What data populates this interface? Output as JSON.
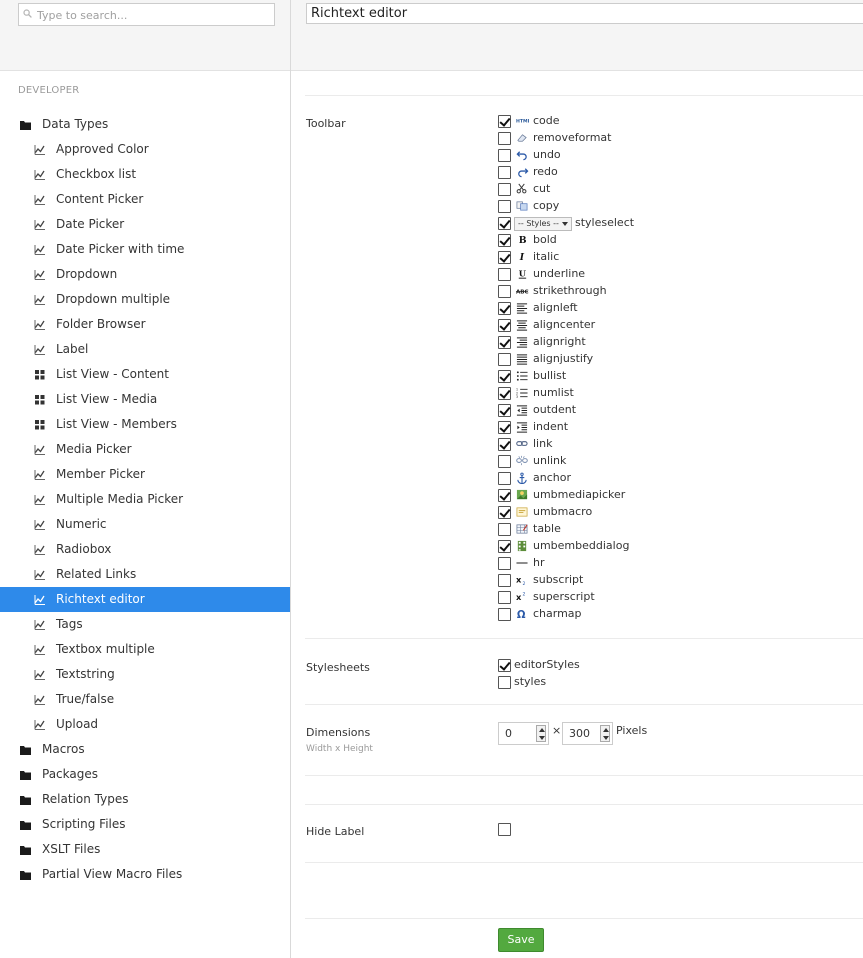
{
  "search": {
    "placeholder": "Type to search..."
  },
  "section": {
    "title": "DEVELOPER"
  },
  "tree": [
    {
      "label": "Data Types",
      "level": 0,
      "icon": "folder-icon"
    },
    {
      "label": "Approved Color",
      "level": 1,
      "icon": "datatype-icon"
    },
    {
      "label": "Checkbox list",
      "level": 1,
      "icon": "datatype-icon"
    },
    {
      "label": "Content Picker",
      "level": 1,
      "icon": "datatype-icon"
    },
    {
      "label": "Date Picker",
      "level": 1,
      "icon": "datatype-icon"
    },
    {
      "label": "Date Picker with time",
      "level": 1,
      "icon": "datatype-icon"
    },
    {
      "label": "Dropdown",
      "level": 1,
      "icon": "datatype-icon"
    },
    {
      "label": "Dropdown multiple",
      "level": 1,
      "icon": "datatype-icon"
    },
    {
      "label": "Folder Browser",
      "level": 1,
      "icon": "datatype-icon"
    },
    {
      "label": "Label",
      "level": 1,
      "icon": "datatype-icon"
    },
    {
      "label": "List View - Content",
      "level": 1,
      "icon": "grid-icon"
    },
    {
      "label": "List View - Media",
      "level": 1,
      "icon": "grid-icon"
    },
    {
      "label": "List View - Members",
      "level": 1,
      "icon": "grid-icon"
    },
    {
      "label": "Media Picker",
      "level": 1,
      "icon": "datatype-icon"
    },
    {
      "label": "Member Picker",
      "level": 1,
      "icon": "datatype-icon"
    },
    {
      "label": "Multiple Media Picker",
      "level": 1,
      "icon": "datatype-icon"
    },
    {
      "label": "Numeric",
      "level": 1,
      "icon": "datatype-icon"
    },
    {
      "label": "Radiobox",
      "level": 1,
      "icon": "datatype-icon"
    },
    {
      "label": "Related Links",
      "level": 1,
      "icon": "datatype-icon"
    },
    {
      "label": "Richtext editor",
      "level": 1,
      "icon": "datatype-icon",
      "selected": true
    },
    {
      "label": "Tags",
      "level": 1,
      "icon": "datatype-icon"
    },
    {
      "label": "Textbox multiple",
      "level": 1,
      "icon": "datatype-icon"
    },
    {
      "label": "Textstring",
      "level": 1,
      "icon": "datatype-icon"
    },
    {
      "label": "True/false",
      "level": 1,
      "icon": "datatype-icon"
    },
    {
      "label": "Upload",
      "level": 1,
      "icon": "datatype-icon"
    },
    {
      "label": "Macros",
      "level": 0,
      "icon": "folder-icon"
    },
    {
      "label": "Packages",
      "level": 0,
      "icon": "folder-icon"
    },
    {
      "label": "Relation Types",
      "level": 0,
      "icon": "folder-icon"
    },
    {
      "label": "Scripting Files",
      "level": 0,
      "icon": "folder-icon"
    },
    {
      "label": "XSLT Files",
      "level": 0,
      "icon": "folder-icon"
    },
    {
      "label": "Partial View Macro Files",
      "level": 0,
      "icon": "folder-icon"
    }
  ],
  "editor": {
    "name": "Richtext editor"
  },
  "toolbar": {
    "label": "Toolbar",
    "styles_select_text": "-- Styles --",
    "items": [
      {
        "name": "code",
        "checked": true,
        "icon": "html-icon"
      },
      {
        "name": "removeformat",
        "checked": false,
        "icon": "eraser-icon"
      },
      {
        "name": "undo",
        "checked": false,
        "icon": "undo-icon"
      },
      {
        "name": "redo",
        "checked": false,
        "icon": "redo-icon"
      },
      {
        "name": "cut",
        "checked": false,
        "icon": "scissors-icon"
      },
      {
        "name": "copy",
        "checked": false,
        "icon": "copy-icon"
      },
      {
        "name": "styleselect",
        "checked": true,
        "icon": "styles-dropdown"
      },
      {
        "name": "bold",
        "checked": true,
        "icon": "bold-icon"
      },
      {
        "name": "italic",
        "checked": true,
        "icon": "italic-icon"
      },
      {
        "name": "underline",
        "checked": false,
        "icon": "underline-icon"
      },
      {
        "name": "strikethrough",
        "checked": false,
        "icon": "strikethrough-icon"
      },
      {
        "name": "alignleft",
        "checked": true,
        "icon": "align-left-icon"
      },
      {
        "name": "aligncenter",
        "checked": true,
        "icon": "align-center-icon"
      },
      {
        "name": "alignright",
        "checked": true,
        "icon": "align-right-icon"
      },
      {
        "name": "alignjustify",
        "checked": false,
        "icon": "align-justify-icon"
      },
      {
        "name": "bullist",
        "checked": true,
        "icon": "bullet-list-icon"
      },
      {
        "name": "numlist",
        "checked": true,
        "icon": "number-list-icon"
      },
      {
        "name": "outdent",
        "checked": true,
        "icon": "outdent-icon"
      },
      {
        "name": "indent",
        "checked": true,
        "icon": "indent-icon"
      },
      {
        "name": "link",
        "checked": true,
        "icon": "link-icon"
      },
      {
        "name": "unlink",
        "checked": false,
        "icon": "unlink-icon"
      },
      {
        "name": "anchor",
        "checked": false,
        "icon": "anchor-icon"
      },
      {
        "name": "umbmediapicker",
        "checked": true,
        "icon": "media-picker-icon"
      },
      {
        "name": "umbmacro",
        "checked": true,
        "icon": "macro-icon"
      },
      {
        "name": "table",
        "checked": false,
        "icon": "table-icon"
      },
      {
        "name": "umbembeddialog",
        "checked": true,
        "icon": "embed-icon"
      },
      {
        "name": "hr",
        "checked": false,
        "icon": "hr-icon"
      },
      {
        "name": "subscript",
        "checked": false,
        "icon": "subscript-icon"
      },
      {
        "name": "superscript",
        "checked": false,
        "icon": "superscript-icon"
      },
      {
        "name": "charmap",
        "checked": false,
        "icon": "omega-icon"
      }
    ]
  },
  "stylesheets": {
    "label": "Stylesheets",
    "items": [
      {
        "name": "editorStyles",
        "checked": true
      },
      {
        "name": "styles",
        "checked": false
      }
    ]
  },
  "dimensions": {
    "label": "Dimensions",
    "description": "Width x Height",
    "width": "0",
    "height": "300",
    "separator": "×",
    "unit": "Pixels"
  },
  "hide_label": {
    "label": "Hide Label",
    "checked": false
  },
  "save_label": "Save",
  "colors": {
    "selected": "#2e8aea",
    "save": "#53a93f"
  }
}
